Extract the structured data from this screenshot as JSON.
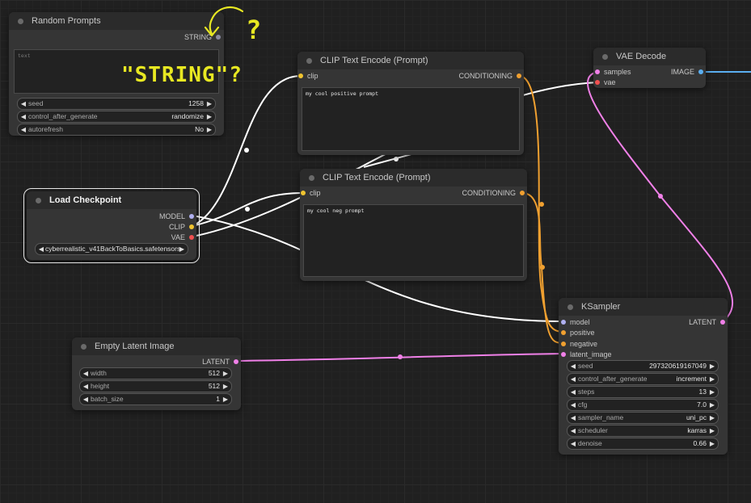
{
  "colors": {
    "clip": "#f0c430",
    "conditioning": "#f0a030",
    "model": "#b0b0f0",
    "vae": "#f05050",
    "latent": "#f080e8",
    "image": "#5aaef0",
    "string": "#8a8aa0",
    "annotation": "#e8e822"
  },
  "nodes": {
    "random_prompts": {
      "title": "Random Prompts",
      "output_string": "STRING",
      "textarea_placeholder": "text",
      "widgets": [
        {
          "label": "seed",
          "value": "1258"
        },
        {
          "label": "control_after_generate",
          "value": "randomize"
        },
        {
          "label": "autorefresh",
          "value": "No"
        }
      ]
    },
    "load_checkpoint": {
      "title": "Load Checkpoint",
      "outputs": [
        "MODEL",
        "CLIP",
        "VAE"
      ],
      "ckpt_name": "cyberrealistic_v41BackToBasics.safetensors"
    },
    "clip_pos": {
      "title": "CLIP Text Encode (Prompt)",
      "input": "clip",
      "output": "CONDITIONING",
      "text": "my cool positive prompt"
    },
    "clip_neg": {
      "title": "CLIP Text Encode (Prompt)",
      "input": "clip",
      "output": "CONDITIONING",
      "text": "my cool neg prompt"
    },
    "vae_decode": {
      "title": "VAE Decode",
      "inputs": [
        "samples",
        "vae"
      ],
      "output": "IMAGE"
    },
    "empty_latent": {
      "title": "Empty Latent Image",
      "output": "LATENT",
      "widgets": [
        {
          "label": "width",
          "value": "512"
        },
        {
          "label": "height",
          "value": "512"
        },
        {
          "label": "batch_size",
          "value": "1"
        }
      ]
    },
    "ksampler": {
      "title": "KSampler",
      "inputs": [
        "model",
        "positive",
        "negative",
        "latent_image"
      ],
      "output": "LATENT",
      "widgets": [
        {
          "label": "seed",
          "value": "297320619167049"
        },
        {
          "label": "control_after_generate",
          "value": "increment"
        },
        {
          "label": "steps",
          "value": "13"
        },
        {
          "label": "cfg",
          "value": "7.0"
        },
        {
          "label": "sampler_name",
          "value": "uni_pc"
        },
        {
          "label": "scheduler",
          "value": "karras"
        },
        {
          "label": "denoise",
          "value": "0.66"
        }
      ]
    }
  },
  "annotation": {
    "text": "\"STRING\"?",
    "question_mark": "?"
  }
}
